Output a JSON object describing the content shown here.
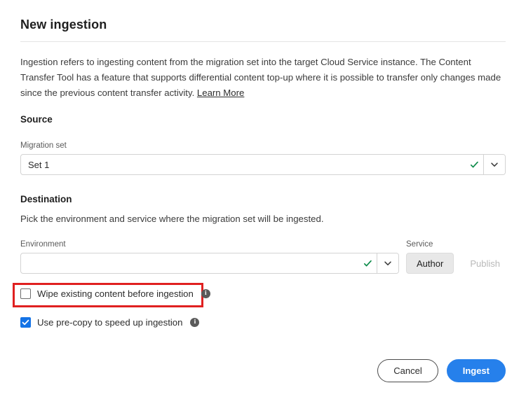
{
  "dialog": {
    "title": "New ingestion",
    "intro_text": "Ingestion refers to ingesting content from the migration set into the target Cloud Service instance. The Content Transfer Tool has a feature that supports differential content top-up where it is possible to transfer only changes made since the previous content transfer activity. ",
    "learn_more_label": "Learn More"
  },
  "source": {
    "heading": "Source",
    "migration_set": {
      "label": "Migration set",
      "value": "Set 1",
      "placeholder": "",
      "valid_icon": "checkmark-icon",
      "arrow_icon": "chevron-down-icon"
    }
  },
  "destination": {
    "heading": "Destination",
    "description": "Pick the environment and service where the migration set will be ingested.",
    "environment": {
      "label": "Environment",
      "value": "",
      "placeholder": "",
      "valid_icon": "checkmark-icon",
      "arrow_icon": "chevron-down-icon"
    },
    "service": {
      "label": "Service",
      "options": [
        {
          "label": "Author",
          "selected": true
        },
        {
          "label": "Publish",
          "selected": false
        }
      ]
    }
  },
  "options": [
    {
      "label": "Wipe existing content before ingestion",
      "checked": false,
      "info_icon": "info-icon",
      "highlighted": true
    },
    {
      "label": "Use pre-copy to speed up ingestion",
      "checked": true,
      "info_icon": "info-icon",
      "highlighted": false
    }
  ],
  "footer": {
    "cancel_label": "Cancel",
    "ingest_label": "Ingest"
  },
  "colors": {
    "primary": "#2680EB",
    "checkbox_checked": "#1473E6",
    "valid_check": "#0D8B4A",
    "highlight_border": "#E02020",
    "text": "#2C2C2C",
    "label_text": "#5A5A5A",
    "disabled_text": "#B9B9B9"
  }
}
